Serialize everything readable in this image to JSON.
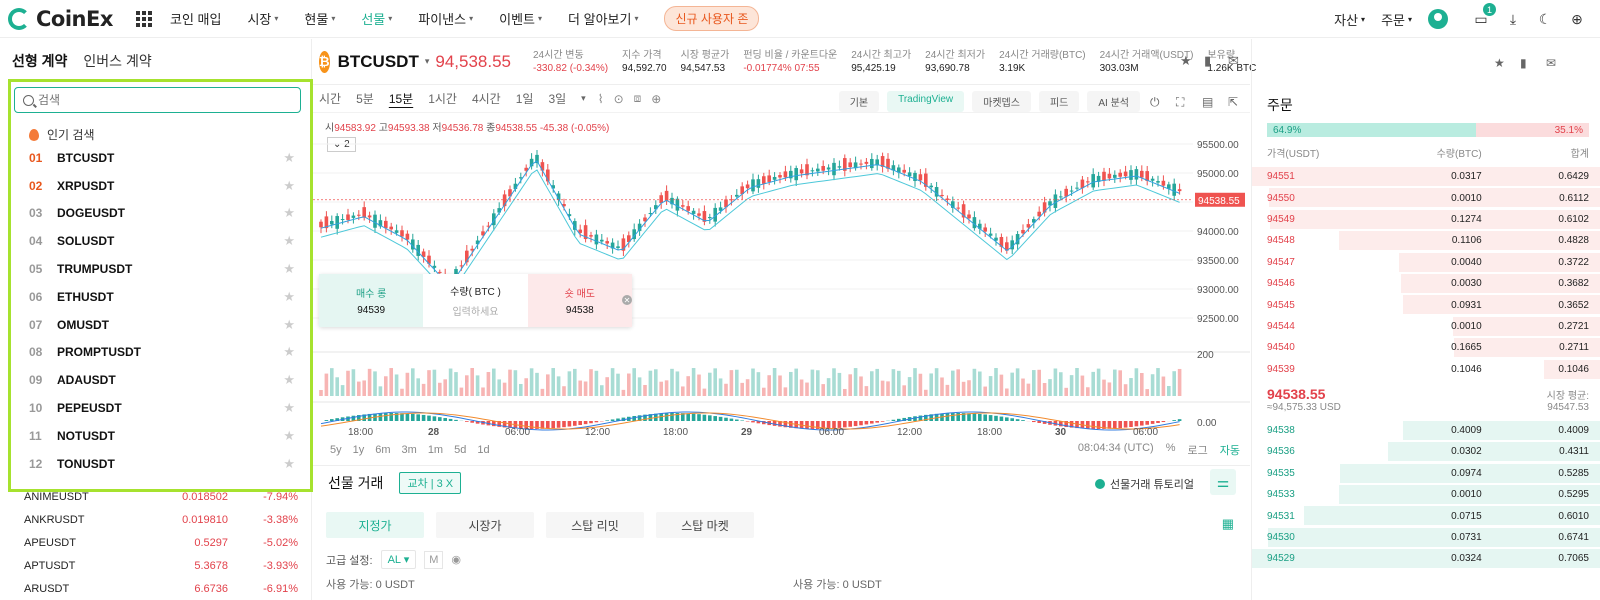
{
  "nav": {
    "logo": "CoinEx",
    "items": [
      {
        "label": "코인 매입",
        "active": false
      },
      {
        "label": "시장",
        "active": false
      },
      {
        "label": "현물",
        "active": false
      },
      {
        "label": "선물",
        "active": true
      },
      {
        "label": "파이낸스",
        "active": false
      },
      {
        "label": "이벤트",
        "active": false
      },
      {
        "label": "더 알아보기",
        "active": false
      }
    ],
    "promo": "신규 사용자 존",
    "assets": "자산",
    "orders": "주문",
    "notif_count": "1"
  },
  "left": {
    "tab_linear": "선형 계약",
    "tab_inverse": "인버스 계약",
    "search_placeholder": "검색",
    "hot_title": "인기 검색",
    "hot": [
      {
        "rank": "01",
        "sym": "BTCUSDT"
      },
      {
        "rank": "02",
        "sym": "XRPUSDT"
      },
      {
        "rank": "03",
        "sym": "DOGEUSDT"
      },
      {
        "rank": "04",
        "sym": "SOLUSDT"
      },
      {
        "rank": "05",
        "sym": "TRUMPUSDT"
      },
      {
        "rank": "06",
        "sym": "ETHUSDT"
      },
      {
        "rank": "07",
        "sym": "OMUSDT"
      },
      {
        "rank": "08",
        "sym": "PROMPTUSDT"
      },
      {
        "rank": "09",
        "sym": "ADAUSDT"
      },
      {
        "rank": "10",
        "sym": "PEPEUSDT"
      },
      {
        "rank": "11",
        "sym": "NOTUSDT"
      },
      {
        "rank": "12",
        "sym": "TONUSDT"
      }
    ],
    "markets": [
      {
        "sym": "ANIMEUSDT",
        "price": "0.018502",
        "chg": "-7.94%"
      },
      {
        "sym": "ANKRUSDT",
        "price": "0.019810",
        "chg": "-3.38%"
      },
      {
        "sym": "APEUSDT",
        "price": "0.5297",
        "chg": "-5.02%"
      },
      {
        "sym": "APTUSDT",
        "price": "5.3678",
        "chg": "-3.93%"
      },
      {
        "sym": "ARUSDT",
        "price": "6.6736",
        "chg": "-6.91%"
      }
    ]
  },
  "ticker": {
    "icon": "₿",
    "pair": "BTCUSDT",
    "last": "94,538.55",
    "stats": [
      {
        "l": "24시간 변동",
        "v": "-330.82 (-0.34%)",
        "red": true
      },
      {
        "l": "지수 가격",
        "v": "94,592.70",
        "red": false
      },
      {
        "l": "시장 평균가",
        "v": "94,547.53",
        "red": false
      },
      {
        "l": "펀딩 비율 / 카운트다운",
        "v": "-0.01774%  07:55",
        "red": true
      },
      {
        "l": "24시간 최고가",
        "v": "95,425.19",
        "red": false
      },
      {
        "l": "24시간 최저가",
        "v": "93,690.78",
        "red": false
      },
      {
        "l": "24시간 거래량(BTC)",
        "v": "3.19K",
        "red": false
      },
      {
        "l": "24시간 거래액(USDT)",
        "v": "303.03M",
        "red": false
      },
      {
        "l": "보유량",
        "v": "1.26K BTC",
        "red": false
      }
    ]
  },
  "chart": {
    "timeframes": [
      "시간",
      "5분",
      "15분",
      "1시간",
      "4시간",
      "1일",
      "3일"
    ],
    "active_tf": "15분",
    "views": [
      "기본",
      "TradingView",
      "마켓뎁스",
      "피드",
      "AI 분석"
    ],
    "active_view": "TradingView",
    "ohlc": {
      "o_l": "시",
      "o": "94583.92",
      "h_l": "고",
      "h": "94593.38",
      "l_l": "저",
      "l": "94536.78",
      "c_l": "종",
      "c": "94538.55",
      "chg": "-45.38 (-0.05%)"
    },
    "indicator_count": "2",
    "price_ticks": [
      "95500.00",
      "95000.00",
      "94500.00",
      "94000.00",
      "93500.00",
      "93000.00",
      "92500.00"
    ],
    "current_price": "94538.55",
    "vol_tick": "200",
    "macd_tick": "0.00",
    "time_ticks": [
      "18:00",
      "28",
      "06:00",
      "12:00",
      "18:00",
      "29",
      "06:00",
      "12:00",
      "18:00",
      "30",
      "06:00"
    ],
    "ranges": [
      "5y",
      "1y",
      "6m",
      "3m",
      "1m",
      "5d",
      "1d"
    ],
    "clock": "08:04:34 (UTC)",
    "pct": "%",
    "log": "로그",
    "auto": "자동"
  },
  "order_pop": {
    "buy_label": "매수 롱",
    "buy_price": "94539",
    "qty_label": "수량( BTC )",
    "qty_placeholder": "입력하세요",
    "sell_label": "숏 매도",
    "sell_price": "94538"
  },
  "futures": {
    "title": "선물 거래",
    "cross": "교차 | 3 X",
    "tutorial": "선물거래 튜토리얼",
    "order_types": [
      "지정가",
      "시장가",
      "스탑 리밋",
      "스탑 마켓"
    ],
    "adv_label": "고급 설정:",
    "adv_al": "AL",
    "adv_m": "M",
    "avail1": "사용 가능: 0 USDT",
    "avail2": "사용 가능: 0 USDT"
  },
  "orderbook": {
    "title": "주문",
    "buy_ratio": "64.9%",
    "sell_ratio": "35.1%",
    "buy_ratio_value": 64.9,
    "col_price": "가격(USDT)",
    "col_qty": "수량(BTC)",
    "col_total": "합계",
    "asks": [
      {
        "p": "94551",
        "q": "0.0317",
        "t": "0.6429"
      },
      {
        "p": "94550",
        "q": "0.0010",
        "t": "0.6112"
      },
      {
        "p": "94549",
        "q": "0.1274",
        "t": "0.6102"
      },
      {
        "p": "94548",
        "q": "0.1106",
        "t": "0.4828"
      },
      {
        "p": "94547",
        "q": "0.0040",
        "t": "0.3722"
      },
      {
        "p": "94546",
        "q": "0.0030",
        "t": "0.3682"
      },
      {
        "p": "94545",
        "q": "0.0931",
        "t": "0.3652"
      },
      {
        "p": "94544",
        "q": "0.0010",
        "t": "0.2721"
      },
      {
        "p": "94540",
        "q": "0.1665",
        "t": "0.2711"
      },
      {
        "p": "94539",
        "q": "0.1046",
        "t": "0.1046"
      }
    ],
    "mid_price": "94538.55",
    "mid_usd": "≈94,575.33  USD",
    "mark_label": "시장 평균:",
    "mark_value": "94547.53",
    "bids": [
      {
        "p": "94538",
        "q": "0.4009",
        "t": "0.4009"
      },
      {
        "p": "94536",
        "q": "0.0302",
        "t": "0.4311"
      },
      {
        "p": "94535",
        "q": "0.0974",
        "t": "0.5285"
      },
      {
        "p": "94533",
        "q": "0.0010",
        "t": "0.5295"
      },
      {
        "p": "94531",
        "q": "0.0715",
        "t": "0.6010"
      },
      {
        "p": "94530",
        "q": "0.0731",
        "t": "0.6741"
      },
      {
        "p": "94529",
        "q": "0.0324",
        "t": "0.7065"
      }
    ]
  }
}
